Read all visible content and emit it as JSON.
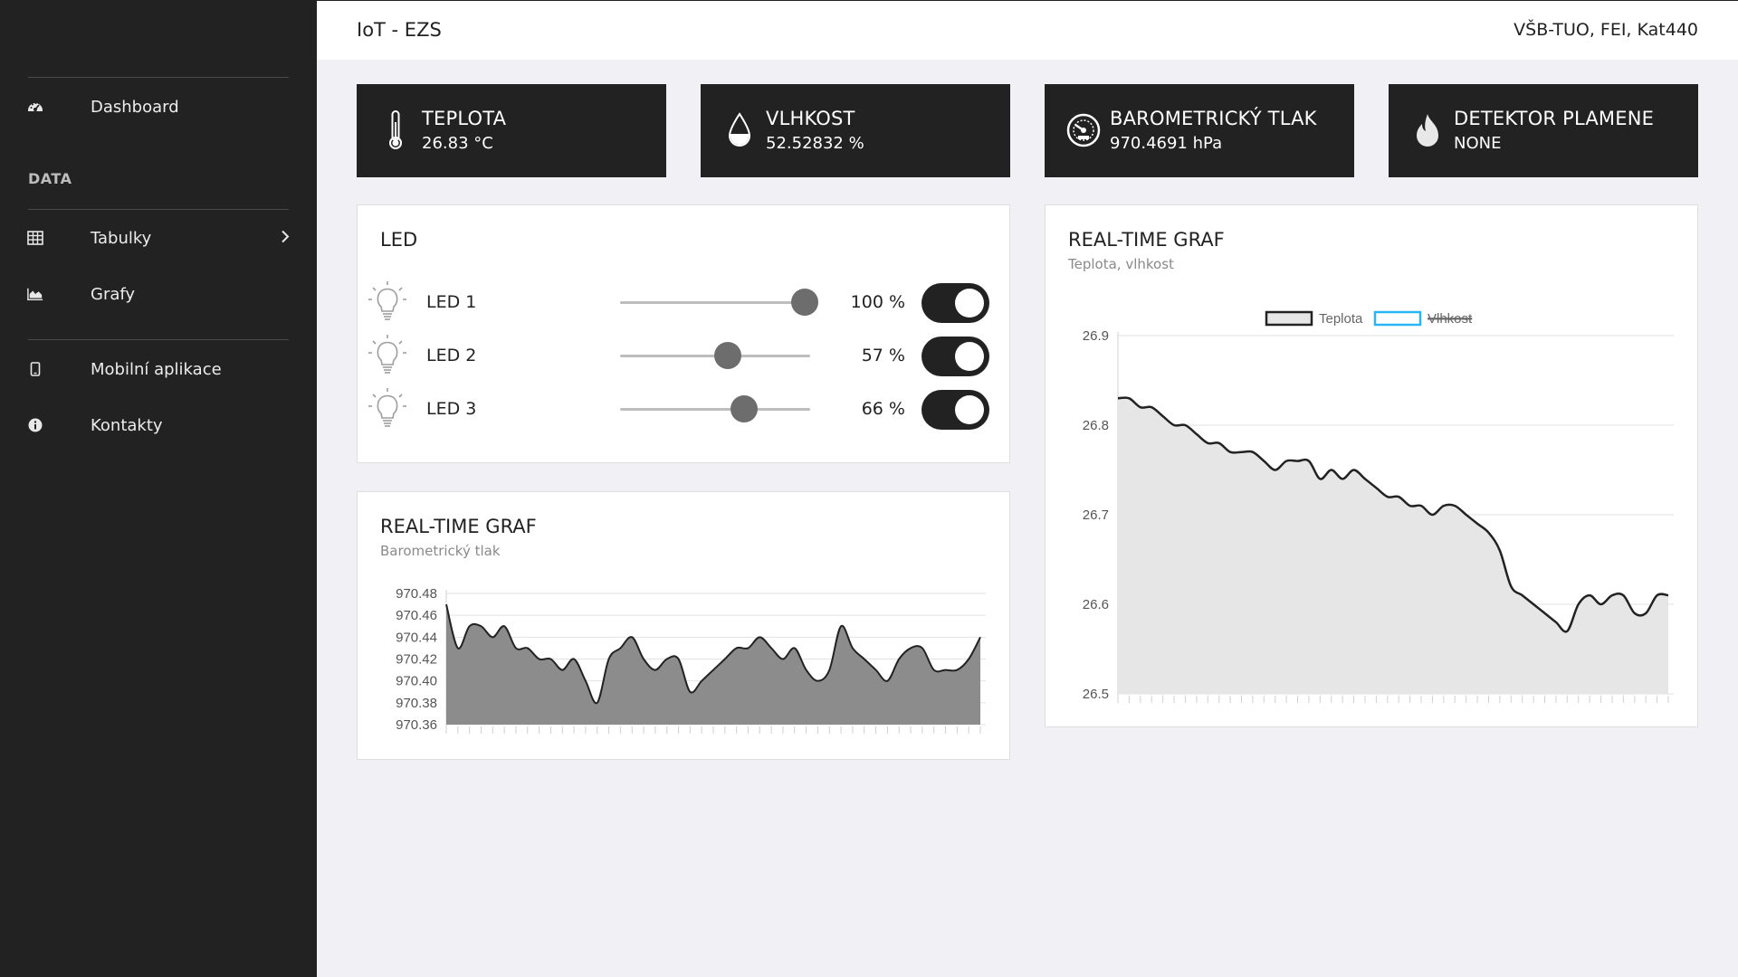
{
  "header": {
    "title": "IoT - EZS",
    "org": "VŠB-TUO, FEI, Kat440"
  },
  "sidebar": {
    "dashboard": {
      "label": "Dashboard",
      "icon": "dashboard-icon"
    },
    "section_heading": "DATA",
    "items": [
      {
        "label": "Tabulky",
        "icon": "table-icon"
      },
      {
        "label": "Grafy",
        "icon": "area-chart-icon"
      },
      {
        "label": "Mobilní aplikace",
        "icon": "mobile-icon"
      },
      {
        "label": "Kontakty",
        "icon": "info-icon"
      }
    ]
  },
  "tiles": [
    {
      "title": "TEPLOTA",
      "value": "26.83 °C",
      "icon": "thermometer-icon"
    },
    {
      "title": "VLHKOST",
      "value": "52.52832 %",
      "icon": "droplet-icon"
    },
    {
      "title": "BAROMETRICKÝ TLAK",
      "value": "970.4691 hPa",
      "icon": "gauge-icon"
    },
    {
      "title": "DETEKTOR PLAMENE",
      "value": "NONE",
      "icon": "flame-icon"
    }
  ],
  "led_card": {
    "title": "LED",
    "leds": [
      {
        "name": "LED 1",
        "percent_label": "100 %",
        "level": 100,
        "on": true
      },
      {
        "name": "LED 2",
        "percent_label": "57 %",
        "level": 57,
        "on": true
      },
      {
        "name": "LED 3",
        "percent_label": "66 %",
        "level": 66,
        "on": true
      }
    ]
  },
  "colors": {
    "dark": "#222222",
    "accent_humidity": "#29b6f6",
    "area_fill": "#e6e6e6",
    "pressure_fill": "#8c8c8c"
  },
  "chart_data": [
    {
      "type": "area",
      "title": "REAL-TIME GRAF",
      "subtitle": "Teplota, vlhkost",
      "ylim": [
        26.5,
        26.9
      ],
      "yticks": [
        "26.5",
        "26.6",
        "26.7",
        "26.8",
        "26.9"
      ],
      "legend": {
        "placement": "top-center"
      },
      "series": [
        {
          "name": "Teplota",
          "color": "#222222",
          "hidden": false,
          "values": [
            26.83,
            26.83,
            26.82,
            26.82,
            26.81,
            26.8,
            26.8,
            26.79,
            26.78,
            26.78,
            26.77,
            26.77,
            26.77,
            26.76,
            26.75,
            26.76,
            26.76,
            26.76,
            26.74,
            26.75,
            26.74,
            26.75,
            26.74,
            26.73,
            26.72,
            26.72,
            26.71,
            26.71,
            26.7,
            26.71,
            26.71,
            26.7,
            26.69,
            26.68,
            26.66,
            26.62,
            26.61,
            26.6,
            26.59,
            26.58,
            26.57,
            26.6,
            26.61,
            26.6,
            26.61,
            26.61,
            26.59,
            26.59,
            26.61,
            26.61
          ]
        },
        {
          "name": "Vlhkost",
          "color": "#29b6f6",
          "hidden": true,
          "values": []
        }
      ]
    },
    {
      "type": "area",
      "title": "REAL-TIME GRAF",
      "subtitle": "Barometrický tlak",
      "ylim": [
        970.36,
        970.48
      ],
      "yticks": [
        "970.36",
        "970.38",
        "970.40",
        "970.42",
        "970.44",
        "970.46",
        "970.48"
      ],
      "series": [
        {
          "color": "#8c8c8c",
          "values": [
            970.47,
            970.43,
            970.45,
            970.45,
            970.44,
            970.45,
            970.43,
            970.43,
            970.42,
            970.42,
            970.41,
            970.42,
            970.4,
            970.38,
            970.42,
            970.43,
            970.44,
            970.42,
            970.41,
            970.42,
            970.42,
            970.39,
            970.4,
            970.41,
            970.42,
            970.43,
            970.43,
            970.44,
            970.43,
            970.42,
            970.43,
            970.41,
            970.4,
            970.41,
            970.45,
            970.43,
            970.42,
            970.41,
            970.4,
            970.42,
            970.43,
            970.43,
            970.41,
            970.41,
            970.41,
            970.42,
            970.44
          ]
        }
      ]
    }
  ]
}
